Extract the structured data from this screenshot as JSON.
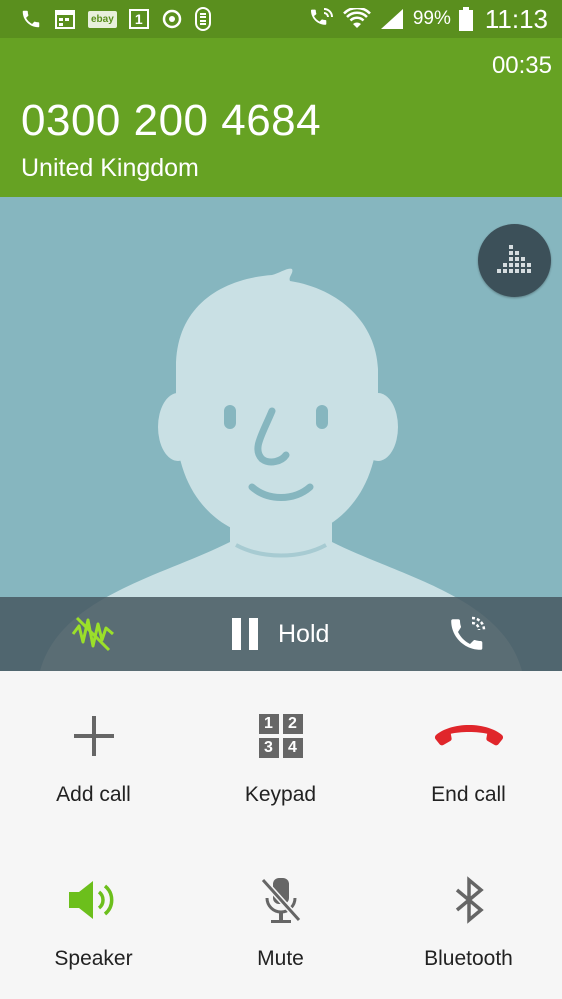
{
  "status_bar": {
    "ebay_label": "ebay",
    "calendar_day": "1",
    "battery": "99%",
    "time": "11:13"
  },
  "call": {
    "duration": "00:35",
    "number": "0300 200 4684",
    "location": "United Kingdom"
  },
  "call_bar": {
    "hold_label": "Hold"
  },
  "controls": {
    "add_call": "Add call",
    "keypad": "Keypad",
    "keypad_digits": [
      "1",
      "2",
      "3",
      "4"
    ],
    "end_call": "End call",
    "speaker": "Speaker",
    "mute": "Mute",
    "bluetooth": "Bluetooth"
  },
  "colors": {
    "header": "#66a223",
    "status_bar": "#5a8f1e",
    "photo_bg": "#86b6bf",
    "end_call": "#e0262b",
    "speaker_active": "#6cbf1c"
  }
}
